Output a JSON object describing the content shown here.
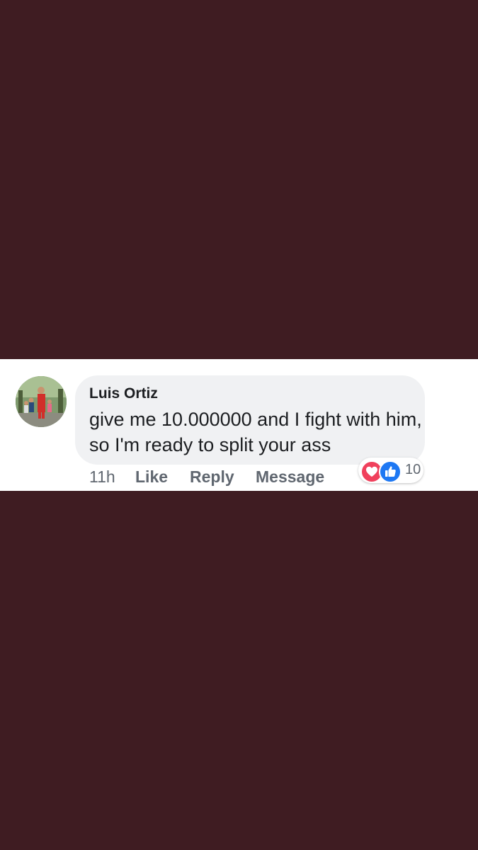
{
  "comment": {
    "author": "Luis Ortiz",
    "text": "give me 10.000000 and I fight with him, so I'm ready to split your ass",
    "time": "11h",
    "actions": {
      "like": "Like",
      "reply": "Reply",
      "message": "Message"
    },
    "reactions": {
      "icons": [
        "love-icon",
        "like-icon"
      ],
      "count": "10"
    }
  },
  "colors": {
    "background": "#3f1c22",
    "bubble": "#f0f1f3",
    "love": "#f0405c",
    "like": "#1e78f3"
  }
}
